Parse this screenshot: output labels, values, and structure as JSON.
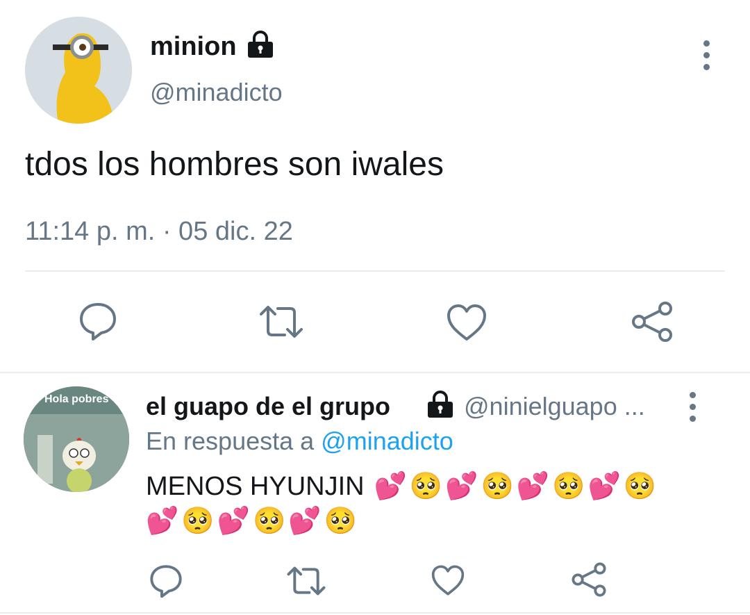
{
  "tweet": {
    "author_name": "minion",
    "author_handle": "@minadicto",
    "text": "tdos los hombres son iwales",
    "timestamp": "11:14 p. m. · 05 dic. 22",
    "actions": [
      "reply-icon",
      "retweet-icon",
      "like-icon",
      "share-icon"
    ]
  },
  "reply": {
    "author_name": "el guapo de el grupo",
    "author_handle": "@ninielguapo ...",
    "reply_prefix": "En respuesta a",
    "reply_to": "@minadicto",
    "text_line1": "MENOS HYUNJIN",
    "emoji_line1": [
      "💕",
      "🥺",
      "💕",
      "🥺",
      "💕",
      "🥺",
      "💕",
      "🥺"
    ],
    "emoji_line2": [
      "💕",
      "🥺",
      "💕",
      "🥺",
      "💕",
      "🥺"
    ],
    "avatar_caption": "Hola pobres"
  },
  "colors": {
    "text": "#14171a",
    "muted": "#657786",
    "link": "#1da1f2",
    "divider": "#e6ecf0"
  }
}
